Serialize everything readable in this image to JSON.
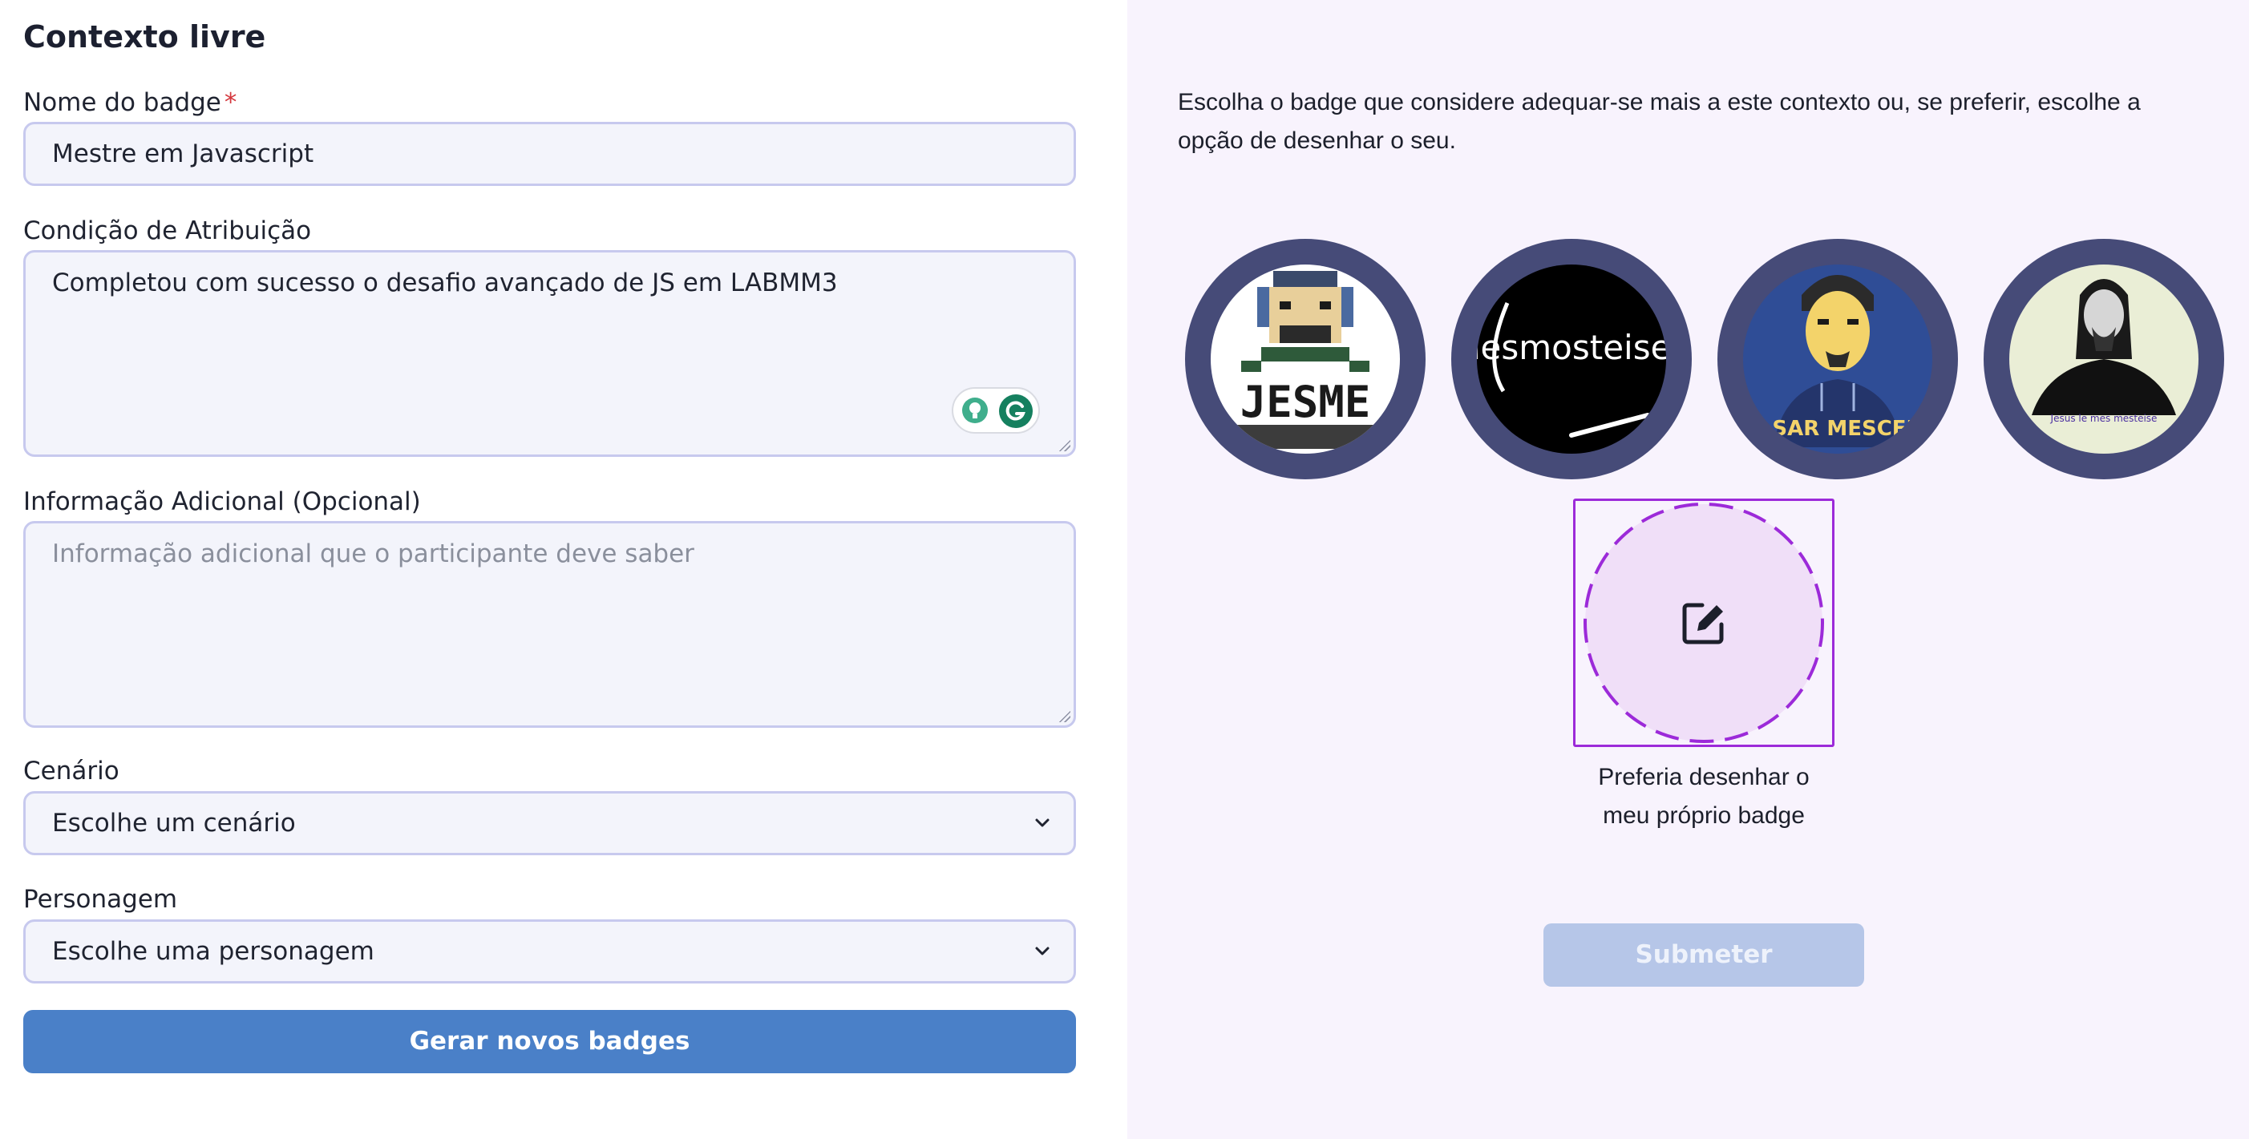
{
  "form": {
    "title": "Contexto livre",
    "badge_name": {
      "label": "Nome do badge",
      "required_mark": "*",
      "value": "Mestre em Javascript"
    },
    "condition": {
      "label": "Condição de Atribuição",
      "value": "Completou com sucesso o desafio avançado de JS em LABMM3"
    },
    "extra_info": {
      "label": "Informação Adicional (Opcional)",
      "placeholder": "Informação adicional que o participante deve saber"
    },
    "scenario": {
      "label": "Cenário",
      "selected": "Escolhe um cenário"
    },
    "character": {
      "label": "Personagem",
      "selected": "Escolhe uma personagem"
    },
    "generate_button": "Gerar novos badges"
  },
  "badges_panel": {
    "intro": "Escolha o badge que considere adequar-se mais a este contexto ou, se preferir, escolhe a opção de desenhar o seu.",
    "badges": [
      {
        "id": "badge-1",
        "text": "JESME"
      },
      {
        "id": "badge-2",
        "text": "mesmosteise"
      },
      {
        "id": "badge-3",
        "text": "SAR MESCER"
      },
      {
        "id": "badge-4",
        "text": "Jesus le mes mesteise"
      }
    ],
    "draw_option_caption_line1": "Preferia desenhar o",
    "draw_option_caption_line2": "meu próprio badge",
    "submit_button": "Submeter"
  },
  "colors": {
    "primary_button": "#4a80c8",
    "submit_disabled": "#b6c6e8",
    "badge_ring": "#464b78",
    "accent_purple": "#9c2ad9",
    "right_panel_bg": "#f8f3fd",
    "input_border": "#c7c9ee"
  }
}
